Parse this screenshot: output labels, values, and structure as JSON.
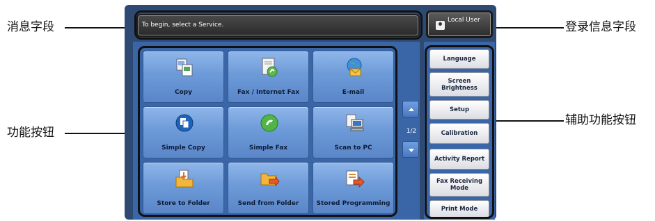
{
  "callouts": {
    "message_field": "消息字段",
    "login_info_field": "登录信息字段",
    "function_buttons": "功能按钮",
    "auxiliary_function_buttons": "辅助功能按钮"
  },
  "message_bar": {
    "text": "To begin, select a Service."
  },
  "login": {
    "label": "Local User"
  },
  "services": [
    {
      "label": "Copy",
      "icon": "copy-icon"
    },
    {
      "label": "Fax / Internet Fax",
      "icon": "fax-icon"
    },
    {
      "label": "E-mail",
      "icon": "email-globe-icon"
    },
    {
      "label": "Simple Copy",
      "icon": "simple-copy-icon"
    },
    {
      "label": "Simple Fax",
      "icon": "simple-fax-icon"
    },
    {
      "label": "Scan to PC",
      "icon": "scan-to-pc-icon"
    },
    {
      "label": "Store to Folder",
      "icon": "store-folder-icon"
    },
    {
      "label": "Send from Folder",
      "icon": "send-folder-icon"
    },
    {
      "label": "Stored Programming",
      "icon": "stored-programming-icon"
    }
  ],
  "pager": {
    "indicator": "1/2"
  },
  "auxiliary": [
    {
      "label": "Language"
    },
    {
      "label": "Screen Brightness"
    },
    {
      "label": "Setup"
    },
    {
      "label": "Calibration"
    },
    {
      "label": "Activity Report"
    },
    {
      "label": "Fax Receiving Mode"
    },
    {
      "label": "Print Mode"
    }
  ],
  "colors": {
    "panel_blue": "#3a66a8",
    "button_blue": "#6d9ad8",
    "message_bar": "#3a3a3a",
    "aux_button": "#e8e9ee"
  }
}
